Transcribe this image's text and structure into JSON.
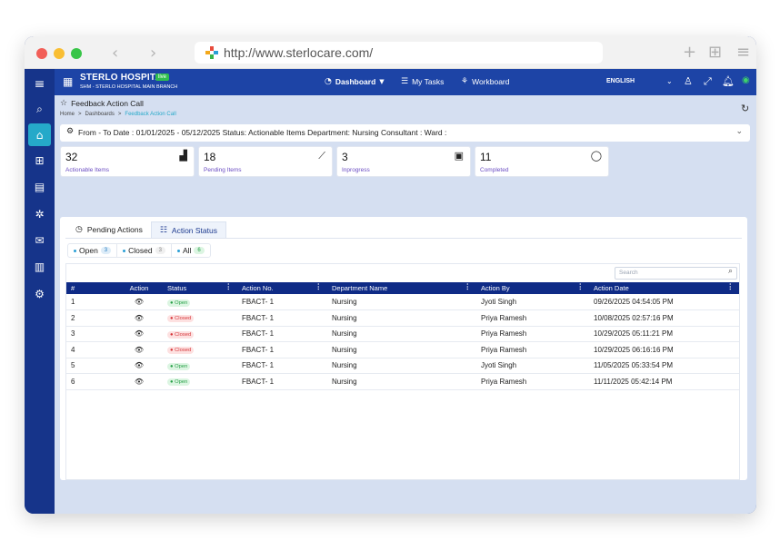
{
  "browser": {
    "url": "http://www.sterlocare.com/"
  },
  "header": {
    "hospital_name": "STERLO HOSPITAL",
    "live_badge": "live",
    "branch": "SHM - STERLO HOSPITAL MAIN BRANCH",
    "nav": [
      {
        "label": "Dashboard",
        "icon": "dashboard-icon"
      },
      {
        "label": "My Tasks",
        "icon": "tasks-icon"
      },
      {
        "label": "Workboard",
        "icon": "workboard-icon"
      }
    ],
    "language": "ENGLISH"
  },
  "sidebar": {
    "icons": [
      "search-icon",
      "home-icon",
      "grid-icon",
      "document-icon",
      "network-icon",
      "mail-icon",
      "library-icon",
      "settings-icon"
    ]
  },
  "page": {
    "title": "Feedback Action Call",
    "breadcrumb": [
      "Home",
      "Dashboards",
      "Feedback Action Call"
    ],
    "filter_summary": "From - To Date : 01/01/2025 - 05/12/2025 Status: Actionable Items Department: Nursing Consultant : Ward :"
  },
  "stats": [
    {
      "value": "32",
      "label": "Actionable Items",
      "icon": "bar-chart-icon"
    },
    {
      "value": "18",
      "label": "Pending Items",
      "icon": "trend-chart-icon"
    },
    {
      "value": "3",
      "label": "Inprogress",
      "icon": "file-icon"
    },
    {
      "value": "11",
      "label": "Completed",
      "icon": "comment-icon"
    }
  ],
  "tabs": [
    {
      "label": "Pending Actions",
      "icon": "clock-icon"
    },
    {
      "label": "Action Status",
      "icon": "list-icon"
    }
  ],
  "status_filters": [
    {
      "label": "Open",
      "count": "3"
    },
    {
      "label": "Closed",
      "count": "3"
    },
    {
      "label": "All",
      "count": "6"
    }
  ],
  "search": {
    "placeholder": "Search"
  },
  "table": {
    "columns": [
      "#",
      "Action",
      "Status",
      "Action No.",
      "Department Name",
      "Action By",
      "Action Date"
    ],
    "rows": [
      {
        "num": "1",
        "status": "Open",
        "action_no": "FBACT- 1",
        "department": "Nursing",
        "action_by": "Jyoti Singh",
        "date": "09/26/2025 04:54:05 PM"
      },
      {
        "num": "2",
        "status": "Closed",
        "action_no": "FBACT- 1",
        "department": "Nursing",
        "action_by": "Priya Ramesh",
        "date": "10/08/2025 02:57:16 PM"
      },
      {
        "num": "3",
        "status": "Closed",
        "action_no": "FBACT- 1",
        "department": "Nursing",
        "action_by": "Priya Ramesh",
        "date": "10/29/2025 05:11:21 PM"
      },
      {
        "num": "4",
        "status": "Closed",
        "action_no": "FBACT- 1",
        "department": "Nursing",
        "action_by": "Priya Ramesh",
        "date": "10/29/2025 06:16:16 PM"
      },
      {
        "num": "5",
        "status": "Open",
        "action_no": "FBACT- 1",
        "department": "Nursing",
        "action_by": "Jyoti Singh",
        "date": "11/05/2025 05:33:54 PM"
      },
      {
        "num": "6",
        "status": "Open",
        "action_no": "FBACT- 1",
        "department": "Nursing",
        "action_by": "Priya Ramesh",
        "date": "11/11/2025 05:42:14 PM"
      }
    ]
  },
  "colors": {
    "brand": "#1d44a6",
    "accent": "#25a9c9",
    "open": "#27a047",
    "closed": "#d6363a"
  }
}
